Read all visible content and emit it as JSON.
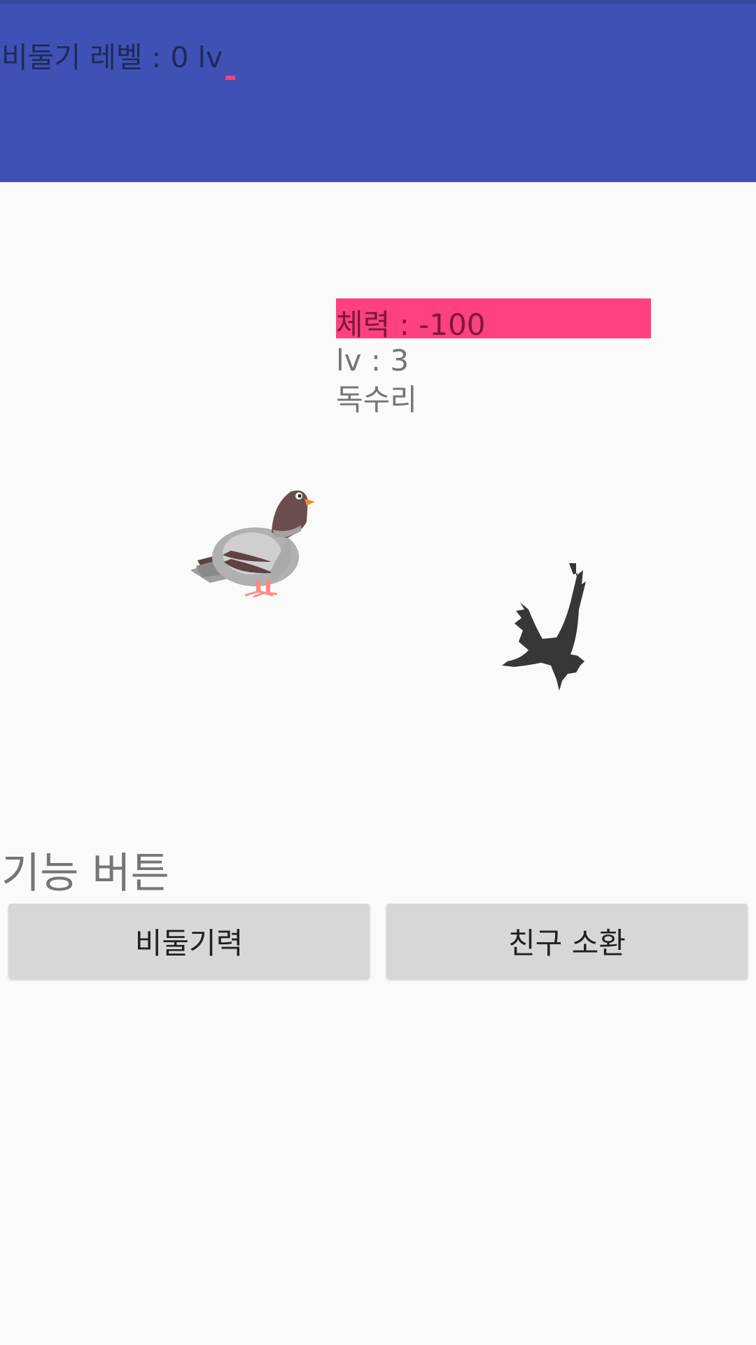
{
  "header": {
    "level_text": "비둘기 레벨 :  0 lv",
    "level_progress": 0.0,
    "background_color": "#3f51b5",
    "accent_color": "#ff4081"
  },
  "enemy": {
    "hp_text": "체력 : -100",
    "level_text": "lv : 3",
    "name": "독수리"
  },
  "sprites": {
    "player": "pigeon-icon",
    "enemy": "eagle-icon"
  },
  "functions": {
    "title": "기능 버튼",
    "attack_button": "비둘기력",
    "summon_button": "친구 소환"
  }
}
